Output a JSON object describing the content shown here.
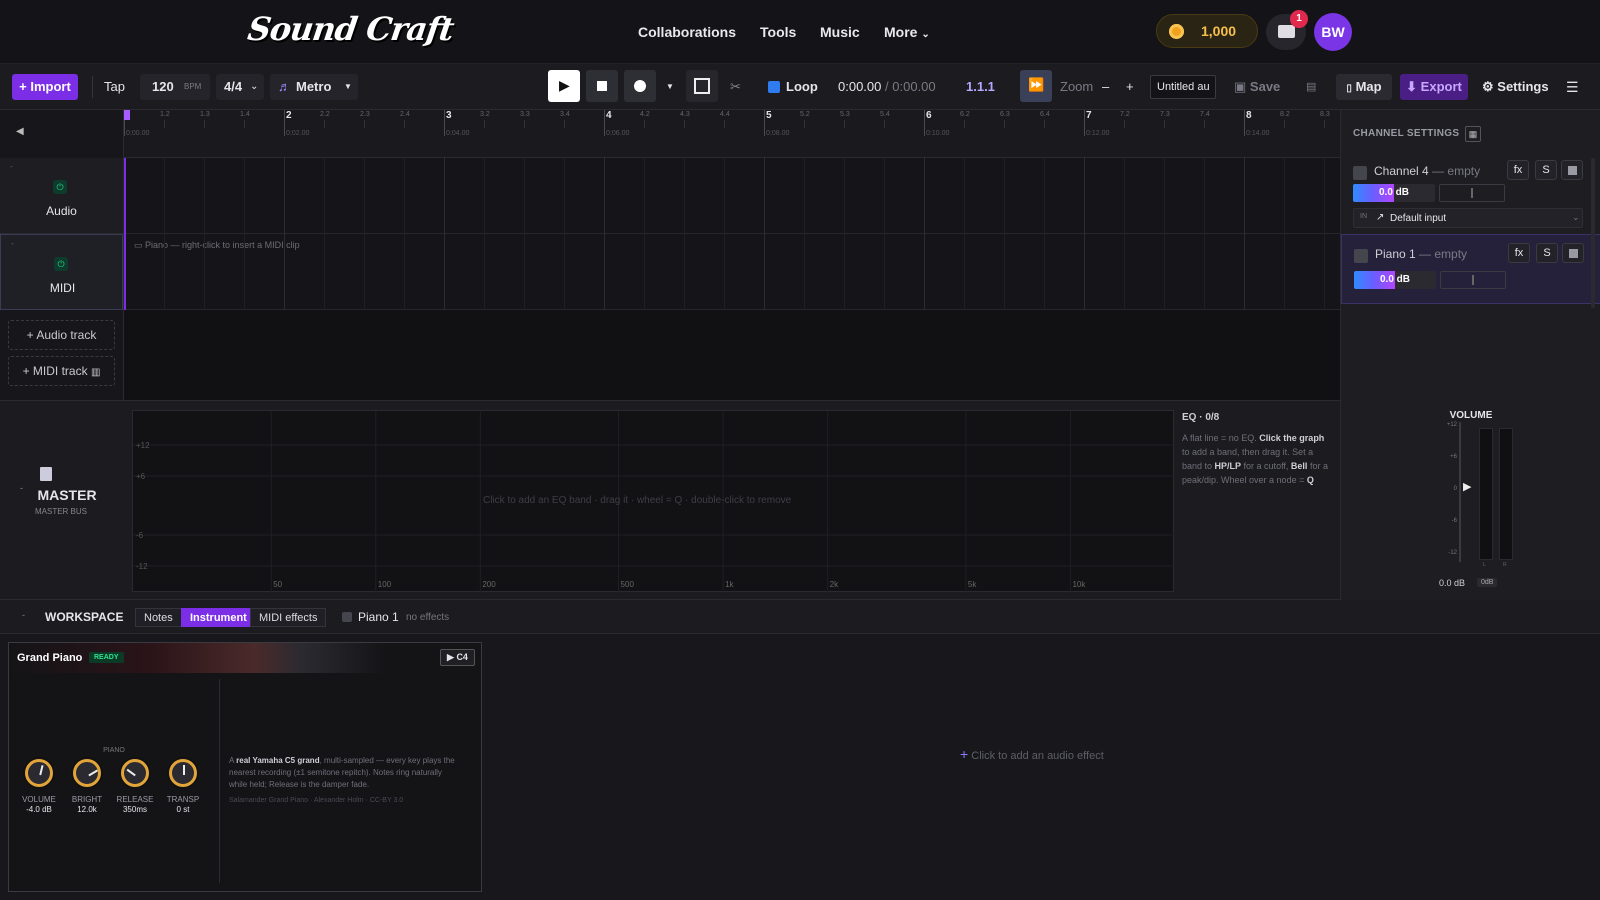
{
  "brand": {
    "logo": "Sound Craft"
  },
  "nav": {
    "links": [
      "Collaborations",
      "Tools",
      "Music",
      "More"
    ]
  },
  "account": {
    "coins": "1,000",
    "notifications": "1",
    "initials": "BW"
  },
  "toolbar": {
    "import": "+ Import",
    "tap": "Tap",
    "bpm": "120",
    "bpm_unit": "BPM",
    "time_sig": "4/4",
    "metro": "Metro",
    "loop": "Loop",
    "time_current": "0:00.00",
    "time_sep": "/",
    "time_total": "0:00.00",
    "position": "1.1.1",
    "zoom": "Zoom",
    "zoom_minus": "–",
    "zoom_plus": "+",
    "project_name": "Untitled au",
    "save": "Save",
    "map": "Map",
    "export": "Export",
    "settings": "Settings"
  },
  "ruler": {
    "bars": [
      "1",
      "2",
      "3",
      "4",
      "5",
      "6",
      "7",
      "8"
    ],
    "sub": [
      "1.2",
      "1.3",
      "1.4",
      "2.2",
      "2.3",
      "2.4",
      "3.2",
      "3.3",
      "3.4",
      "4.2",
      "4.3",
      "4.4",
      "5.2",
      "5.3",
      "5.4",
      "6.2",
      "6.3",
      "6.4",
      "7.2",
      "7.3",
      "7.4",
      "8.2",
      "8.3"
    ],
    "times": [
      "0:00.00",
      "0:02.00",
      "0:04.00",
      "0:06.00",
      "0:08.00",
      "0:10.00",
      "0:12.00",
      "0:14.00"
    ]
  },
  "tracks": {
    "audio": {
      "name": "Audio"
    },
    "midi": {
      "name": "MIDI",
      "hint": "Piano — right-click to insert a MIDI clip"
    },
    "add_audio": "+ Audio track",
    "add_midi": "+ MIDI track"
  },
  "channel_settings": {
    "title": "CHANNEL SETTINGS",
    "channels": [
      {
        "name": "Channel 4",
        "status": "— empty",
        "volume": "0.0 dB",
        "fx": "fx",
        "solo": "S",
        "input_tag": "IN",
        "input": "Default input"
      },
      {
        "name": "Piano 1",
        "status": "— empty",
        "volume": "0.0 dB",
        "fx": "fx",
        "solo": "S"
      }
    ]
  },
  "master": {
    "title": "MASTER",
    "subtitle": "MASTER BUS"
  },
  "eq": {
    "title": "EQ · 0/8",
    "hint_overlay": "Click to add an EQ band · drag it · wheel = Q · double-click to remove",
    "y_ticks": [
      "+12",
      "+6",
      "-6",
      "-12"
    ],
    "x_ticks": [
      "50",
      "100",
      "200",
      "500",
      "1k",
      "2k",
      "5k",
      "10k"
    ],
    "help": [
      {
        "t": "A flat line = no EQ. ",
        "b": false
      },
      {
        "t": "Click the graph",
        "b": true
      },
      {
        "t": " to add a band, then drag it. Set a band to ",
        "b": false
      },
      {
        "t": "HP/LP",
        "b": true
      },
      {
        "t": " for a cutoff, ",
        "b": false
      },
      {
        "t": "Bell",
        "b": true
      },
      {
        "t": " for a peak/dip. Wheel over a node = ",
        "b": false
      },
      {
        "t": "Q",
        "b": true
      }
    ]
  },
  "volume_meter": {
    "title": "VOLUME",
    "ticks": [
      "+12",
      "+6",
      "0",
      "-6",
      "-12"
    ],
    "left": "L",
    "right": "R",
    "value": "0.0 dB",
    "reset": "0dB"
  },
  "workspace": {
    "title": "WORKSPACE",
    "tabs": [
      "Notes",
      "Instrument",
      "MIDI effects"
    ],
    "active_tab": "Instrument",
    "track": "Piano 1",
    "effects_status": "no effects",
    "add_effect": "Click to add an audio effect"
  },
  "instrument": {
    "name": "Grand Piano",
    "status": "READY",
    "preview": "C4",
    "section": "PIANO",
    "knobs": [
      {
        "label": "VOLUME",
        "value": "-4.0 dB",
        "level": 0.55
      },
      {
        "label": "BRIGHT",
        "value": "12.0k",
        "level": 0.72
      },
      {
        "label": "RELEASE",
        "value": "350ms",
        "level": 0.3
      },
      {
        "label": "TRANSP",
        "value": "0 st",
        "level": 0.5
      }
    ],
    "desc_pre": "A ",
    "desc_bold": "real Yamaha C5 grand",
    "desc_post": ", multi-sampled — every key plays the nearest recording (±1 semitone repitch). Notes ring naturally while held; Release is the damper fade.",
    "credit": "Salamander Grand Piano · Alexander Holm · CC-BY 3.0"
  },
  "colors": {
    "accent": "#7c2ee6",
    "coin": "#f0a21c",
    "eq_left": "#32b4ff",
    "eq_right": "#ff3fc4",
    "power": "#29d18c"
  }
}
